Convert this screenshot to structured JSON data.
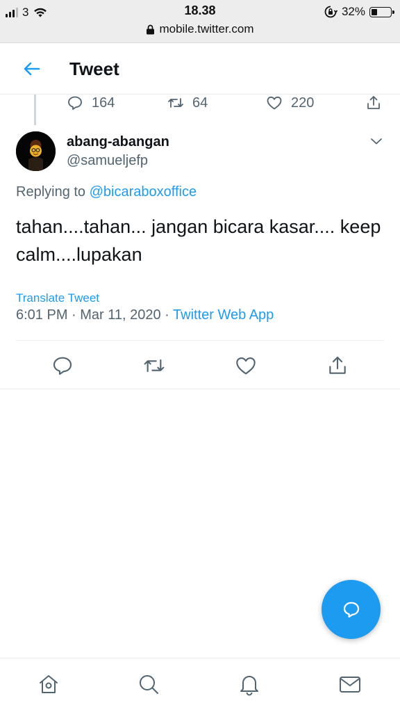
{
  "status_bar": {
    "carrier": "3",
    "time": "18.38",
    "battery": "32%",
    "battery_level": 0.32,
    "url": "mobile.twitter.com"
  },
  "header": {
    "title": "Tweet",
    "back_icon": "arrow-left-icon"
  },
  "previous_tweet_actions": {
    "reply_count": "164",
    "retweet_count": "64",
    "like_count": "220"
  },
  "tweet": {
    "author_name": "abang-abangan",
    "author_handle": "@samueljefp",
    "replying_prefix": "Replying to",
    "replying_to": "@bicaraboxoffice",
    "text": "tahan....tahan... jangan bicara kasar.... keep calm....lupakan",
    "translate_label": "Translate Tweet",
    "timestamp": "6:01 PM · Mar 11, 2020 ·",
    "source_app": "Twitter Web App"
  },
  "actions": [
    "reply-icon",
    "retweet-icon",
    "like-icon",
    "share-icon"
  ],
  "fab": {
    "icon": "compose-reply-icon"
  },
  "bottom_nav": [
    "home-icon",
    "search-icon",
    "notifications-icon",
    "messages-icon"
  ],
  "colors": {
    "accent": "#1d9bf0",
    "text_primary": "#0f1419",
    "text_secondary": "#536471",
    "border": "#e6ecf0"
  }
}
